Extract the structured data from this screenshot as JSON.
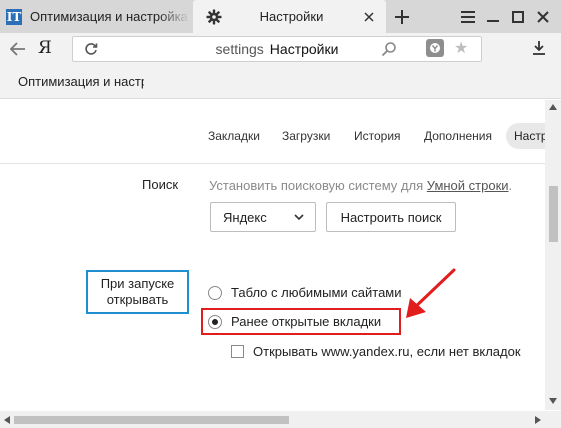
{
  "tabs": [
    {
      "title": "Оптимизация и настройка",
      "favicon": "IT"
    },
    {
      "title": "Настройки",
      "icon": "gear-icon"
    }
  ],
  "toolbar": {
    "logo": "Я",
    "address_prefix": "settings",
    "address_page": "Настройки"
  },
  "bookmarks": {
    "item": "Оптимизация и настройка"
  },
  "settings_nav": {
    "tabs": [
      "Закладки",
      "Загрузки",
      "История",
      "Дополнения"
    ],
    "active": "Настройки"
  },
  "search_section": {
    "label": "Поиск",
    "description": "Установить поисковую систему для",
    "link": "Умной строки",
    "suffix": ".",
    "engine": "Яндекс",
    "config_button": "Настроить поиск"
  },
  "startup_section": {
    "label_line1": "При запуске",
    "label_line2": "открывать",
    "options": [
      {
        "label": "Табло с любимыми сайтами",
        "selected": false
      },
      {
        "label": "Ранее открытые вкладки",
        "selected": true
      }
    ],
    "checkbox_label": "Открывать www.yandex.ru, если нет вкладок",
    "checkbox_checked": false
  },
  "colors": {
    "startup_box": "#1f8fd0",
    "highlight_box": "#e21d1d",
    "arrow": "#e21d1d"
  }
}
